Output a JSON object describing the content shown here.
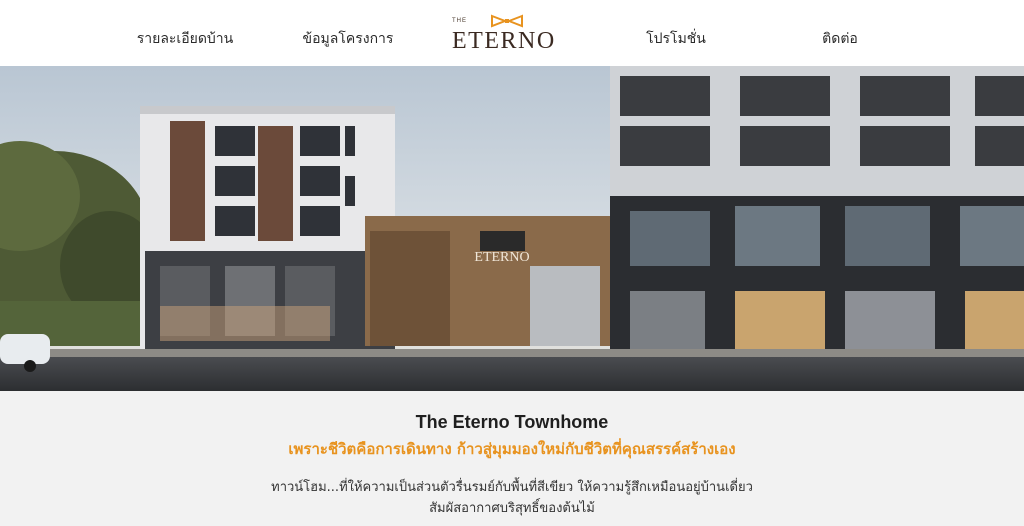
{
  "nav": {
    "items": [
      {
        "label": "รายละเอียดบ้าน"
      },
      {
        "label": "ข้อมูลโครงการ"
      },
      {
        "label": "โปรโมชั่น"
      },
      {
        "label": "ติดต่อ"
      }
    ],
    "logo": {
      "small": "THE",
      "word": "ETERNO"
    }
  },
  "hero": {
    "sign_text": "ETERNO",
    "alt": "The Eterno Townhome building exterior"
  },
  "content": {
    "title": "The Eterno Townhome",
    "tagline": "เพราะชีวิตคือการเดินทาง ก้าวสู่มุมมองใหม่กับชีวิตที่คุณสรรค์สร้างเอง",
    "desc_line1": "ทาวน์โฮม...ที่ให้ความเป็นส่วนตัวรื่นรมย์กับพื้นที่สีเขียว ให้ความรู้สึกเหมือนอยู่บ้านเดี่ยว",
    "desc_line2": "สัมผัสอากาศบริสุทธิ์ของต้นไม้"
  },
  "colors": {
    "accent": "#e8931f",
    "brand": "#3b2a22"
  }
}
